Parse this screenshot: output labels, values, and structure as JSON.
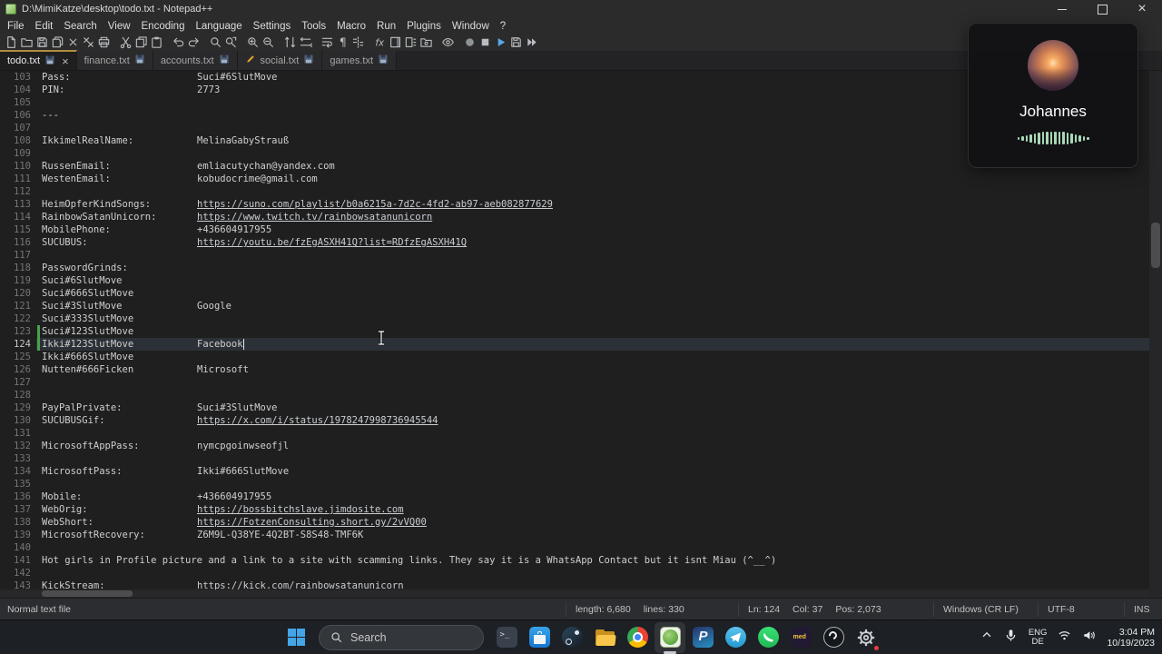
{
  "window": {
    "title": "D:\\MimiKatze\\desktop\\todo.txt - Notepad++"
  },
  "menu": {
    "items": [
      "File",
      "Edit",
      "Search",
      "View",
      "Encoding",
      "Language",
      "Settings",
      "Tools",
      "Macro",
      "Run",
      "Plugins",
      "Window",
      "?"
    ]
  },
  "toolbar": {
    "groups": [
      [
        "new-file",
        "open-file",
        "save",
        "save-all",
        "close",
        "close-all",
        "print"
      ],
      [
        "cut",
        "copy",
        "paste"
      ],
      [
        "undo",
        "redo"
      ],
      [
        "find",
        "replace"
      ],
      [
        "zoom-in",
        "zoom-out"
      ],
      [
        "sync-vertical-scroll",
        "sync-horizontal-scroll"
      ],
      [
        "word-wrap",
        "show-all-characters",
        "indent-guide"
      ],
      [
        "function-list",
        "document-map",
        "document-list",
        "folder-as-workspace"
      ],
      [
        "document-monitoring"
      ],
      [
        "start-recording",
        "stop-recording",
        "playback-macro",
        "save-macro",
        "run-macro-multiple"
      ]
    ]
  },
  "tabs": [
    {
      "label": "todo.txt",
      "active": true,
      "close": true
    },
    {
      "label": "finance.txt"
    },
    {
      "label": "accounts.txt"
    },
    {
      "label": "social.txt",
      "modified": true
    },
    {
      "label": "games.txt"
    }
  ],
  "editor": {
    "current_line": 124,
    "lines": [
      {
        "n": 103,
        "a": "Pass:",
        "b": "Suci#6SlutMove"
      },
      {
        "n": 104,
        "a": "PIN:",
        "b": "2773"
      },
      {
        "n": 105
      },
      {
        "n": 106,
        "a": "---"
      },
      {
        "n": 107
      },
      {
        "n": 108,
        "a": "IkkimelRealName:",
        "b": "MelinaGabyStrauß"
      },
      {
        "n": 109
      },
      {
        "n": 110,
        "a": "RussenEmail:",
        "b": "emliacutychan@yandex.com"
      },
      {
        "n": 111,
        "a": "WestenEmail:",
        "b": "kobudocrime@gmail.com"
      },
      {
        "n": 112
      },
      {
        "n": 113,
        "a": "HeimOpferKindSongs:",
        "b": "https://suno.com/playlist/b0a6215a-7d2c-4fd2-ab97-aeb082877629",
        "link": true
      },
      {
        "n": 114,
        "a": "RainbowSatanUnicorn:",
        "b": "https://www.twitch.tv/rainbowsatanunicorn",
        "link": true
      },
      {
        "n": 115,
        "a": "MobilePhone:",
        "b": "+436604917955"
      },
      {
        "n": 116,
        "a": "SUCUBUS:",
        "b": "https://youtu.be/fzEgASXH41Q?list=RDfzEgASXH41Q",
        "link": true
      },
      {
        "n": 117
      },
      {
        "n": 118,
        "a": "PasswordGrinds:"
      },
      {
        "n": 119,
        "a": "Suci#6SlutMove"
      },
      {
        "n": 120,
        "a": "Suci#666SlutMove"
      },
      {
        "n": 121,
        "a": "Suci#3SlutMove",
        "b": "Google"
      },
      {
        "n": 122,
        "a": "Suci#333SlutMove"
      },
      {
        "n": 123,
        "a": "Suci#123SlutMove",
        "changed": true
      },
      {
        "n": 124,
        "a": "Ikki#123SlutMove",
        "b": "Facebook",
        "current": true,
        "changed": true
      },
      {
        "n": 125,
        "a": "Ikki#666SlutMove"
      },
      {
        "n": 126,
        "a": "Nutten#666Ficken",
        "b": "Microsoft"
      },
      {
        "n": 127
      },
      {
        "n": 128
      },
      {
        "n": 129,
        "a": "PayPalPrivate:",
        "b": "Suci#3SlutMove"
      },
      {
        "n": 130,
        "a": "SUCUBUSGif:",
        "b": "https://x.com/i/status/1978247998736945544",
        "link": true
      },
      {
        "n": 131
      },
      {
        "n": 132,
        "a": "MicrosoftAppPass:",
        "b": "nymcpgoinwseofjl"
      },
      {
        "n": 133
      },
      {
        "n": 134,
        "a": "MicrosoftPass:",
        "b": "Ikki#666SlutMove"
      },
      {
        "n": 135
      },
      {
        "n": 136,
        "a": "Mobile:",
        "b": "+436604917955"
      },
      {
        "n": 137,
        "a": "WebOrig:",
        "b": "https://bossbitchslave.jimdosite.com",
        "link": true
      },
      {
        "n": 138,
        "a": "WebShort:",
        "b": "https://FotzenConsulting.short.gy/2vVQ00",
        "link": true
      },
      {
        "n": 139,
        "a": "MicrosoftRecovery:",
        "b": "Z6M9L-Q38YE-4Q2BT-S8S48-TMF6K"
      },
      {
        "n": 140
      },
      {
        "n": 141,
        "a": "Hot girls in Profile picture and a link to a site with scamming links. They say it is a WhatsApp Contact but it isnt Miau (^__^)"
      },
      {
        "n": 142
      },
      {
        "n": 143,
        "a": "KickStream:",
        "b": "https://kick.com/rainbowsatanunicorn",
        "link": true
      }
    ]
  },
  "status": {
    "doc_type": "Normal text file",
    "length": "length: 6,680",
    "lines": "lines: 330",
    "ln": "Ln: 124",
    "col": "Col: 37",
    "pos": "Pos: 2,073",
    "eol": "Windows (CR LF)",
    "encoding": "UTF-8",
    "typing_mode": "INS"
  },
  "overlay": {
    "name": "Johannes",
    "wave_heights": [
      3,
      5,
      7,
      9,
      11,
      13,
      14,
      14,
      14,
      14,
      14,
      14,
      13,
      11,
      9,
      7,
      5,
      3
    ]
  },
  "taskbar": {
    "search_label": "Search",
    "apps": [
      {
        "name": "terminal"
      },
      {
        "name": "microsoft-store"
      },
      {
        "name": "steam"
      },
      {
        "name": "file-explorer"
      },
      {
        "name": "chrome"
      },
      {
        "name": "notepad-plus-plus",
        "active": true
      },
      {
        "name": "paypal"
      },
      {
        "name": "telegram"
      },
      {
        "name": "whatsapp"
      },
      {
        "name": "medal",
        "label": "med"
      },
      {
        "name": "obs"
      },
      {
        "name": "settings",
        "badge": true
      }
    ],
    "language": {
      "primary": "ENG",
      "secondary": "DE"
    },
    "clock": {
      "time": "3:04 PM",
      "date": "10/19/2023"
    }
  }
}
